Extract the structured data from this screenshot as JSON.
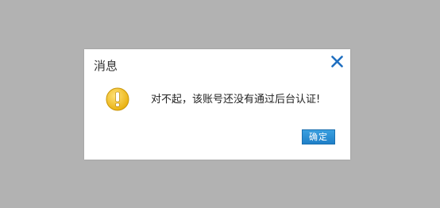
{
  "dialog": {
    "title": "消息",
    "message": "对不起，该账号还没有通过后台认证!",
    "ok_label": "确定",
    "close_icon": "close-icon",
    "warning_icon": "warning-icon"
  },
  "colors": {
    "backdrop": "#b2b2b2",
    "dialog_bg": "#ffffff",
    "close_icon": "#1f6fc0",
    "warning_fill": "#f2c21b",
    "button_bg": "#2a8fd6"
  }
}
